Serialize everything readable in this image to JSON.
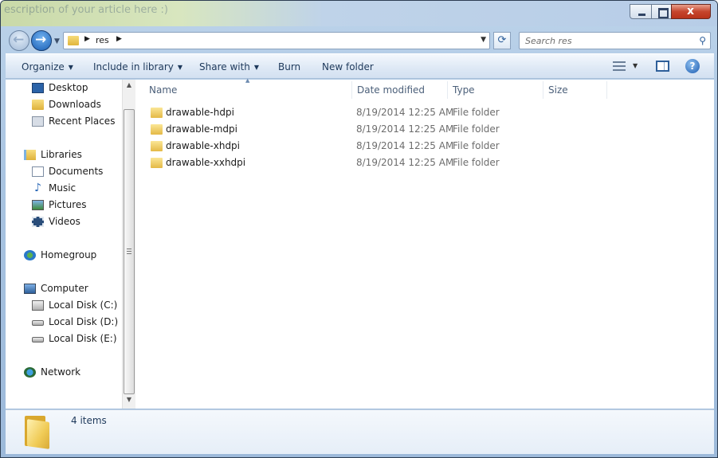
{
  "window": {
    "faded_title": "escription of your article here :)",
    "close_glyph": "x"
  },
  "nav": {
    "back_glyph": "←",
    "forward_glyph": "→",
    "recent_glyph": "▼"
  },
  "address": {
    "breadcrumb_arrow": "▶",
    "crumb": "res",
    "crumb_arrow": "▶",
    "dropdown_glyph": "▼"
  },
  "refresh_glyph": "⟳",
  "search": {
    "placeholder": "Search res",
    "icon_glyph": "⚲"
  },
  "toolbar": {
    "organize": "Organize",
    "include_in_library": "Include in library",
    "share_with": "Share with",
    "burn": "Burn",
    "new_folder": "New folder",
    "caret": "▼",
    "help": "?"
  },
  "sidebar": {
    "favorites": [
      {
        "label": "Desktop",
        "icon": "desktop-icon"
      },
      {
        "label": "Downloads",
        "icon": "folder-icon"
      },
      {
        "label": "Recent Places",
        "icon": "recent-places-icon"
      }
    ],
    "libraries": {
      "label": "Libraries",
      "icon": "libraries-icon"
    },
    "library_items": [
      {
        "label": "Documents",
        "icon": "documents-icon"
      },
      {
        "label": "Music",
        "icon": "music-icon"
      },
      {
        "label": "Pictures",
        "icon": "pictures-icon"
      },
      {
        "label": "Videos",
        "icon": "videos-icon"
      }
    ],
    "homegroup": {
      "label": "Homegroup",
      "icon": "homegroup-icon"
    },
    "computer": {
      "label": "Computer",
      "icon": "computer-icon"
    },
    "drives": [
      {
        "label": "Local Disk (C:)",
        "icon": "system-drive-icon"
      },
      {
        "label": "Local Disk (D:)",
        "icon": "drive-icon"
      },
      {
        "label": "Local Disk (E:)",
        "icon": "drive-icon"
      }
    ],
    "network": {
      "label": "Network",
      "icon": "network-icon"
    },
    "scroll_up": "▲",
    "scroll_down": "▼"
  },
  "columns": {
    "name": "Name",
    "date_modified": "Date modified",
    "type": "Type",
    "size": "Size",
    "sort_indicator": "▲"
  },
  "files": [
    {
      "name": "drawable-hdpi",
      "date": "8/19/2014 12:25 AM",
      "type": "File folder"
    },
    {
      "name": "drawable-mdpi",
      "date": "8/19/2014 12:25 AM",
      "type": "File folder"
    },
    {
      "name": "drawable-xhdpi",
      "date": "8/19/2014 12:25 AM",
      "type": "File folder"
    },
    {
      "name": "drawable-xxhdpi",
      "date": "8/19/2014 12:25 AM",
      "type": "File folder"
    }
  ],
  "status": {
    "count": "4 items"
  }
}
